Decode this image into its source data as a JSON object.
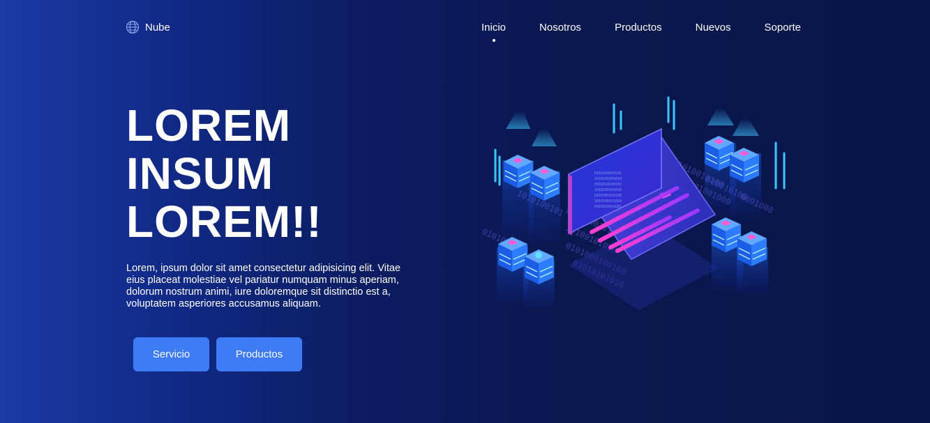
{
  "nav": {
    "brand": "Nube",
    "links": [
      {
        "label": "Inicio",
        "active": true
      },
      {
        "label": "Nosotros",
        "active": false
      },
      {
        "label": "Productos",
        "active": false
      },
      {
        "label": "Nuevos",
        "active": false
      },
      {
        "label": "Soporte",
        "active": false
      }
    ]
  },
  "hero": {
    "title_lines": [
      "LOREM",
      "INSUM",
      "LOREM!!"
    ],
    "description": "Lorem, ipsum dolor sit amet consectetur adipisicing elit. Vitae eius placeat molestiae vel pariatur numquam minus aperiam, dolorum nostrum animi, iure doloremque sit distinctio est a, voluptatem asperiores accusamus aliquam.",
    "buttons": {
      "primary": "Servicio",
      "secondary": "Productos"
    }
  },
  "icons": {
    "brand_icon": "globe-icon",
    "illustration": "isometric-laptop-servers-illustration"
  },
  "colors": {
    "background_left": "#1a3aa6",
    "background_right": "#09164a",
    "button": "#3d7bf7",
    "accent_pink": "#e040c8",
    "accent_cyan": "#3ec6ff"
  }
}
